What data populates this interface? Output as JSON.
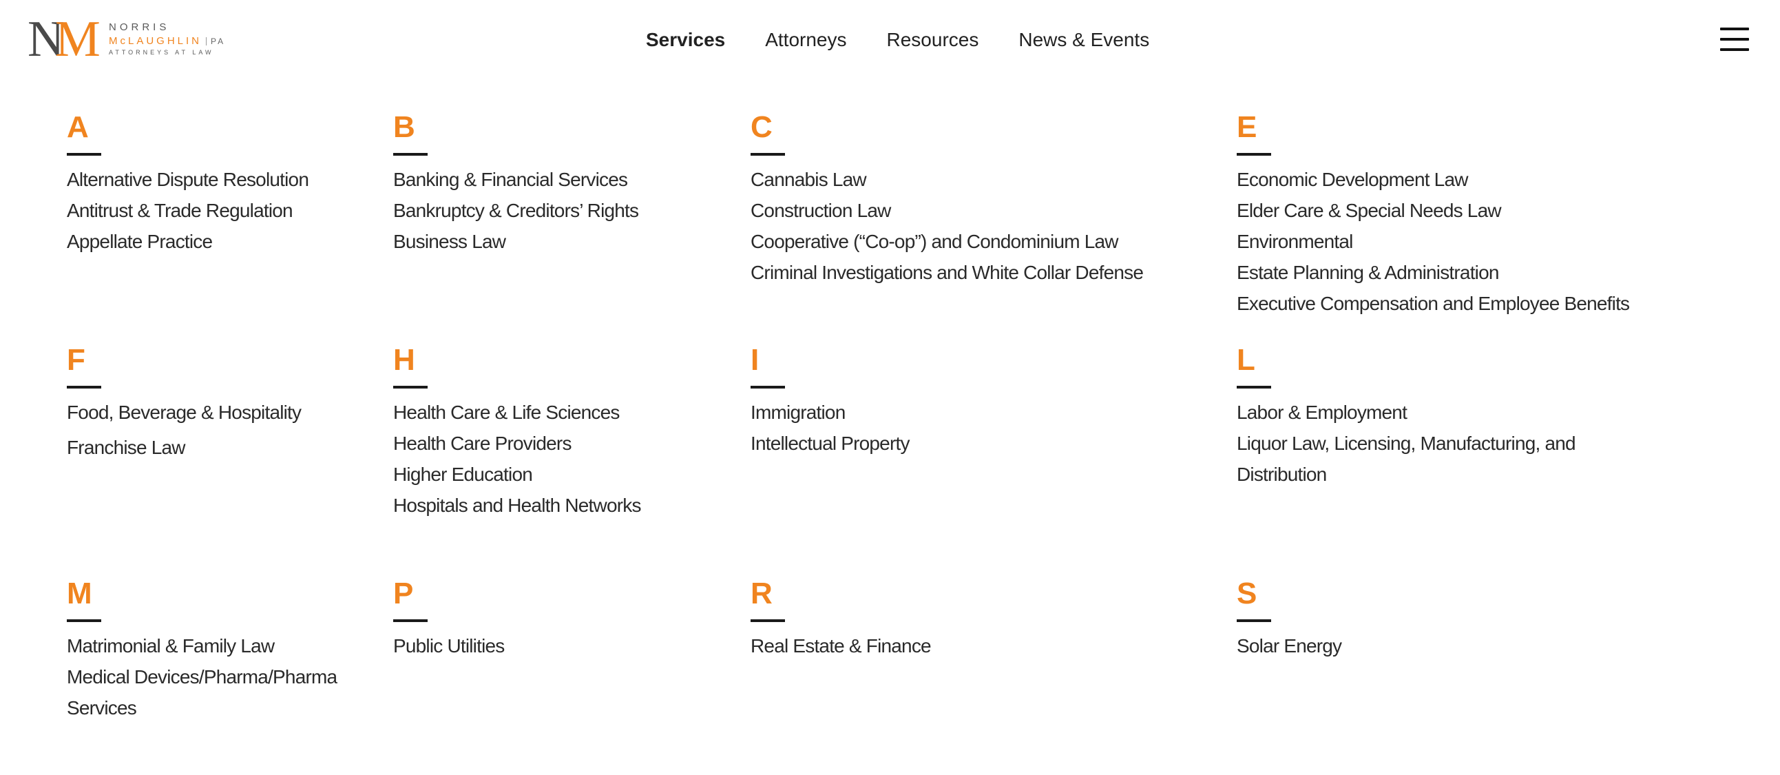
{
  "logo": {
    "mark_n": "N",
    "mark_m": "M",
    "line1": "NORRIS",
    "line2": "McLAUGHLIN",
    "pa": "PA",
    "line3": "ATTORNEYS AT LAW"
  },
  "nav": {
    "items": [
      {
        "label": "Services",
        "active": true
      },
      {
        "label": "Attorneys",
        "active": false
      },
      {
        "label": "Resources",
        "active": false
      },
      {
        "label": "News & Events",
        "active": false
      }
    ]
  },
  "menu_icon": "hamburger-menu-icon",
  "colors": {
    "accent": "#f0841f",
    "text": "#2a2a2a",
    "rule": "#1a1a1a"
  },
  "groups": [
    {
      "letter": "A",
      "items": [
        "Alternative Dispute Resolution",
        "Antitrust & Trade Regulation",
        "Appellate Practice"
      ]
    },
    {
      "letter": "B",
      "items": [
        "Banking & Financial Services",
        "Bankruptcy & Creditors’ Rights",
        "Business Law"
      ]
    },
    {
      "letter": "C",
      "items": [
        "Cannabis Law",
        "Construction Law",
        "Cooperative (“Co-op”) and Condominium Law",
        "Criminal Investigations and White Collar Defense"
      ]
    },
    {
      "letter": "E",
      "items": [
        "Economic Development Law",
        "Elder Care & Special Needs Law",
        "Environmental",
        "Estate Planning & Administration",
        "Executive Compensation and Employee Benefits"
      ]
    },
    {
      "letter": "F",
      "items": [
        "Food, Beverage & Hospitality",
        "Franchise Law"
      ]
    },
    {
      "letter": "H",
      "items": [
        "Health Care & Life Sciences",
        "Health Care Providers",
        "Higher Education",
        "Hospitals and Health Networks"
      ]
    },
    {
      "letter": "I",
      "items": [
        "Immigration",
        "Intellectual Property"
      ]
    },
    {
      "letter": "L",
      "items": [
        "Labor & Employment",
        "Liquor Law, Licensing, Manufacturing, and Distribution"
      ]
    },
    {
      "letter": "M",
      "items": [
        "Matrimonial & Family Law",
        "Medical Devices/Pharma/Pharma Services"
      ]
    },
    {
      "letter": "P",
      "items": [
        "Public Utilities"
      ]
    },
    {
      "letter": "R",
      "items": [
        "Real Estate & Finance"
      ]
    },
    {
      "letter": "S",
      "items": [
        "Solar Energy"
      ]
    }
  ]
}
